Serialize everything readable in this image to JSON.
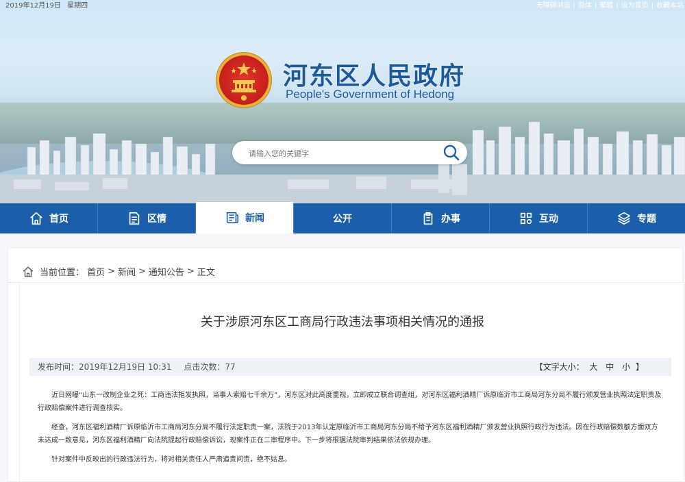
{
  "topbar": {
    "date": "2019年12月19日",
    "weekday": "星期四",
    "links": [
      "无障碍浏览",
      "简体",
      "繁體",
      "设为首页",
      "收藏本站"
    ],
    "separators": [
      "|",
      "|",
      "|",
      "|"
    ]
  },
  "header": {
    "title": "河东区人民政府",
    "subtitle": "People's Government of Hedong"
  },
  "search": {
    "placeholder": "请输入您的关键字"
  },
  "nav": {
    "items": [
      {
        "label": "首页",
        "icon": "home-icon"
      },
      {
        "label": "区情",
        "icon": "document-icon"
      },
      {
        "label": "新闻",
        "icon": "news-icon",
        "active": true
      },
      {
        "label": "公开",
        "icon": "open-icon"
      },
      {
        "label": "办事",
        "icon": "clipboard-icon"
      },
      {
        "label": "互动",
        "icon": "interaction-icon"
      },
      {
        "label": "专题",
        "icon": "layers-icon"
      }
    ]
  },
  "breadcrumb": {
    "label": "当前位置：",
    "items": [
      "首页",
      "新闻",
      "通知公告",
      "正文"
    ],
    "separator": ">"
  },
  "article": {
    "title": "关于涉原河东区工商局行政违法事项相关情况的通报",
    "publish_label": "发布时间：",
    "publish_time": "2019年12月19日 10:31",
    "clicks_label": "点击次数：",
    "clicks": "77",
    "font_size_label": "【文字大小：",
    "font_large": "大",
    "font_medium": "中",
    "font_small": "小",
    "font_size_close": "】",
    "paragraphs": [
      "近日网曝“山东一改制企业之死：工商违法拒发执照，当事人索赔七千余万”，河东区对此高度重视，立即成立联合调查组，对河东区福利酒精厂诉原临沂市工商局河东分局不履行颁发营业执照法定职责及行政赔偿案件进行调查核实。",
      "经查，河东区福利酒精厂诉原临沂市工商局河东分局不履行法定职责一案，法院于2013年认定原临沂市工商局河东分局不给予河东区福利酒精厂颁发营业执照行政行为违法。因在行政赔偿数额方面双方未达成一致意见，河东区福利酒精厂向法院提起行政赔偿诉讼，现案件正在二审程序中。下一步将根据法院审判结果依法依规办理。",
      "针对案件中反映出的行政违法行为，将对相关责任人严肃追责问责，绝不姑息。"
    ]
  },
  "colors": {
    "nav_bg": "#1b5fab",
    "title_blue": "#1e5a9a",
    "emblem_red": "#c8211c",
    "emblem_gold": "#e9b23a"
  }
}
